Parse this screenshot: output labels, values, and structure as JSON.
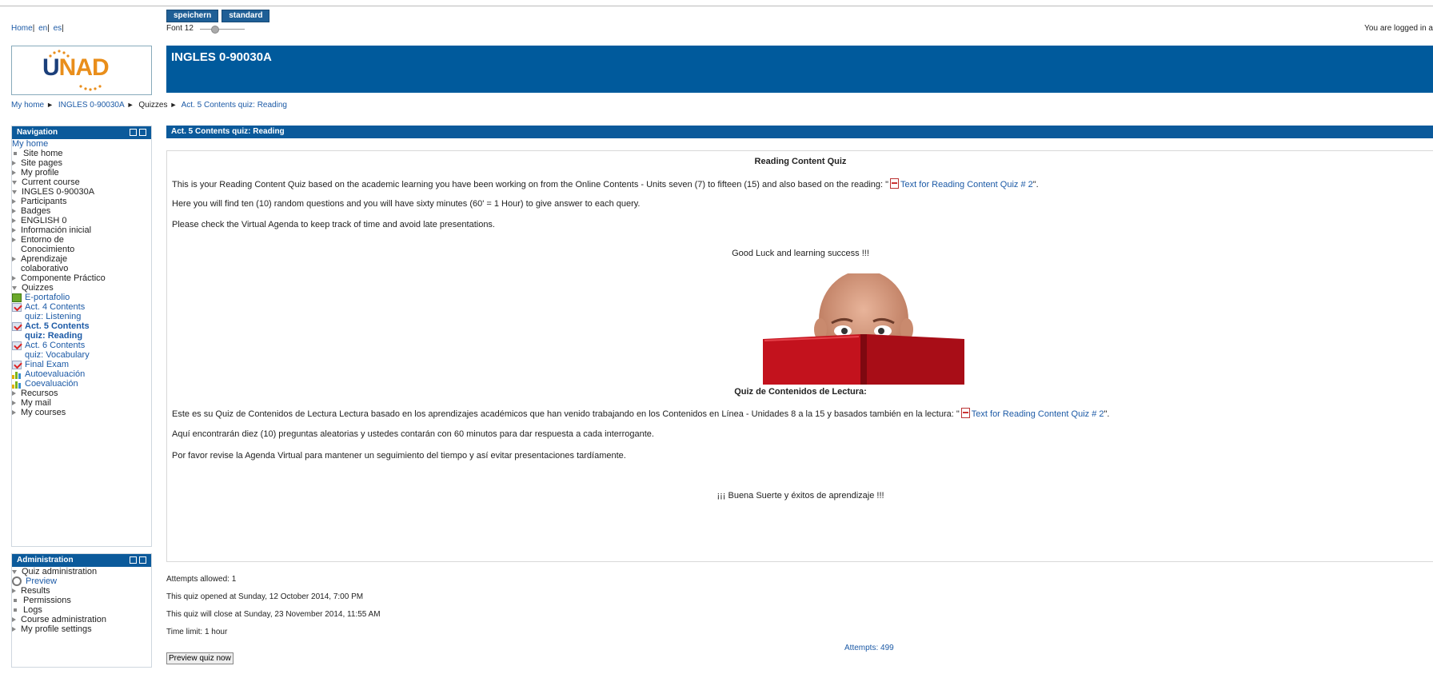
{
  "header": {
    "lang_links": [
      "Home",
      "en",
      "es"
    ],
    "buttons": [
      "speichern",
      "standard"
    ],
    "font_label": "Font 12",
    "logged_in": "You are logged in a",
    "logo_text_u": "U",
    "logo_text_nad": "NAD",
    "course_title": "INGLES 0-90030A"
  },
  "breadcrumb": [
    "My home",
    "INGLES 0-90030A",
    "Quizzes",
    "Act. 5 Contents quiz: Reading"
  ],
  "navigation": {
    "title": "Navigation",
    "items": [
      {
        "label": "My home",
        "icon": "none",
        "level": 0
      },
      {
        "label": "Site home",
        "icon": "dot",
        "level": 1
      },
      {
        "label": "Site pages",
        "icon": "arrow-right",
        "level": 1
      },
      {
        "label": "My profile",
        "icon": "arrow-right",
        "level": 1
      },
      {
        "label": "Current course",
        "icon": "arrow-down",
        "level": 1
      },
      {
        "label": "INGLES 0-90030A",
        "icon": "arrow-down",
        "level": 2
      },
      {
        "label": "Participants",
        "icon": "arrow-right",
        "level": 3
      },
      {
        "label": "Badges",
        "icon": "arrow-right",
        "level": 3
      },
      {
        "label": "ENGLISH 0",
        "icon": "arrow-right",
        "level": 3
      },
      {
        "label": "Información inicial",
        "icon": "arrow-right",
        "level": 3
      },
      {
        "label": "Entorno de",
        "label2": "Conocimiento",
        "icon": "arrow-right",
        "level": 3
      },
      {
        "label": "Aprendizaje",
        "label2": "colaborativo",
        "icon": "arrow-right",
        "level": 3
      },
      {
        "label": "Componente Práctico",
        "icon": "arrow-right",
        "level": 3
      },
      {
        "label": "Quizzes",
        "icon": "arrow-down",
        "level": 3
      },
      {
        "label": "E-portafolio",
        "icon": "green-book",
        "level": 4
      },
      {
        "label": "Act. 4 Contents",
        "label2": "quiz: Listening",
        "icon": "quiz-check",
        "level": 4
      },
      {
        "label": "Act. 5 Contents",
        "label2": "quiz: Reading",
        "icon": "quiz-check",
        "level": 4,
        "current": true
      },
      {
        "label": "Act. 6 Contents",
        "label2": "quiz: Vocabulary",
        "icon": "quiz-check",
        "level": 4
      },
      {
        "label": "Final Exam",
        "icon": "quiz-check",
        "level": 4
      },
      {
        "label": "Autoevaluación",
        "icon": "feedback-bars",
        "level": 4
      },
      {
        "label": "Coevaluación",
        "icon": "feedback-bars",
        "level": 4
      },
      {
        "label": "Recursos",
        "icon": "arrow-right",
        "level": 3
      },
      {
        "label": "My mail",
        "icon": "arrow-right",
        "level": 1
      },
      {
        "label": "My courses",
        "icon": "arrow-right",
        "level": 1
      }
    ]
  },
  "administration": {
    "title": "Administration",
    "items": [
      {
        "label": "Quiz administration",
        "icon": "arrow-down",
        "level": 1
      },
      {
        "label": "Preview",
        "icon": "magnifier",
        "level": 2
      },
      {
        "label": "Results",
        "icon": "arrow-right",
        "level": 2
      },
      {
        "label": "Permissions",
        "icon": "dot",
        "level": 2
      },
      {
        "label": "Logs",
        "icon": "dot",
        "level": 2
      },
      {
        "label": "Course administration",
        "icon": "arrow-right",
        "level": 1
      },
      {
        "label": "My profile settings",
        "icon": "arrow-right",
        "level": 1
      }
    ]
  },
  "quiz": {
    "section_title": "Act. 5 Contents quiz: Reading",
    "heading_en": "Reading Content Quiz",
    "p1_text": "This is your Reading Content Quiz based on the academic learning you have been working on from the Online Contents - Units seven (7) to fifteen (15) and also based on the reading: \"",
    "p1_link": "Text for Reading Content Quiz # 2",
    "p1_end": "\".",
    "p2": "Here you will find ten (10) random questions and you will have sixty minutes (60' = 1 Hour) to give answer to each query.",
    "p3": "Please check the Virtual Agenda to keep track of time and avoid late presentations.",
    "good_luck": "Good Luck and learning success !!!",
    "heading_es": "Quiz de Contenidos de Lectura:",
    "p4_text": "Este es su Quiz de Contenidos de Lectura Lectura basado en los aprendizajes académicos que han venido trabajando en los Contenidos en Línea - Unidades 8 a la 15 y basados también en la lectura: \"",
    "p4_link": "Text for Reading Content Quiz # 2",
    "p4_end": "\".",
    "p5": "Aquí encontrarán diez (10) preguntas aleatorias y ustedes contarán con 60 minutos para dar respuesta a cada interrogante.",
    "p6": "Por favor revise la Agenda Virtual para mantener un seguimiento del tiempo y así evitar presentaciones tardíamente.",
    "buena_suerte": "¡¡¡ Buena Suerte y éxitos de aprendizaje !!!"
  },
  "quiz_info": {
    "attempts_allowed": "Attempts allowed: 1",
    "opened": "This quiz opened at Sunday, 12 October 2014, 7:00 PM",
    "closes": "This quiz will close at Sunday, 23 November 2014, 11:55 AM",
    "time_limit": "Time limit: 1 hour",
    "preview_button": "Preview quiz now",
    "attempts_link": "Attempts: 499"
  },
  "colors": {
    "header_blue": "#005a9c",
    "block_blue": "#0b5a9b",
    "link": "#1c5aa6",
    "logo_orange": "#e98e1b"
  },
  "font_size_setting": 0.3
}
